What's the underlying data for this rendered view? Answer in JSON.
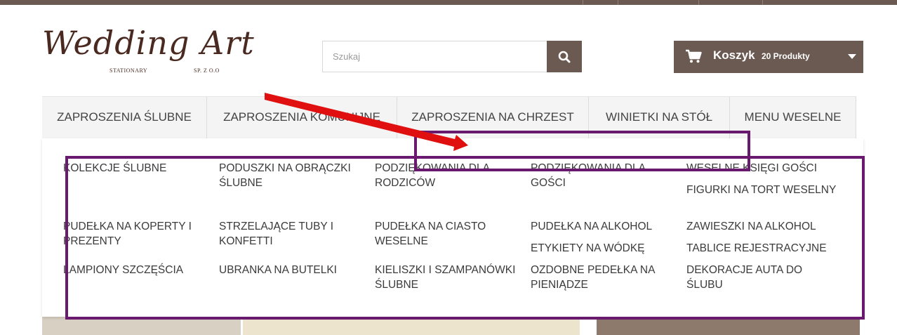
{
  "logo": {
    "title": "Wedding Art",
    "sub_left": "STATIONARY",
    "sub_right": "SP. Z O.O"
  },
  "search": {
    "placeholder": "Szukaj",
    "icon": "search-icon"
  },
  "cart": {
    "label": "Koszyk",
    "count": "20 Produkty",
    "icon": "cart-icon"
  },
  "nav": {
    "items": [
      "ZAPROSZENIA ŚLUBNE",
      "ZAPROSZENIA KOMUNIJNE",
      "ZAPROSZENIA NA CHRZEST",
      "WINIETKI NA STÓŁ",
      "MENU WESELNE"
    ]
  },
  "dropdown": {
    "items": [
      "KOLEKCJE ŚLUBNE",
      "PODUSZKI NA OBRĄCZKI ŚLUBNE",
      "PODZIĘKOWANIA DLA RODZICÓW",
      "PODZIĘKOWANIA DLA GOŚCI",
      "WESELNE KSIĘGI GOŚCI",
      "FIGURKI NA TORT WESELNY",
      "PUDEŁKA NA KOPERTY I PREZENTY",
      "STRZELAJĄCE TUBY I KONFETTI",
      "PUDEŁKA NA CIASTO WESELNE",
      "PUDEŁKA NA ALKOHOL",
      "ZAWIESZKI NA ALKOHOL",
      "ETYKIETY NA WÓDKĘ",
      "TABLICE REJESTRACYJNE",
      "LAMPIONY SZCZĘŚCIA",
      "UBRANKA NA BUTELKI",
      "KIELISZKI I SZAMPANÓWKI ŚLUBNE",
      "OZDOBNE PEDEŁKA NA PIENIĄDZE",
      "DEKORACJE AUTA DO ŚLUBU"
    ]
  },
  "colors": {
    "brand": "#6b5a51",
    "annotation_box": "#6a1a6e",
    "annotation_arrow": "#e01010"
  }
}
